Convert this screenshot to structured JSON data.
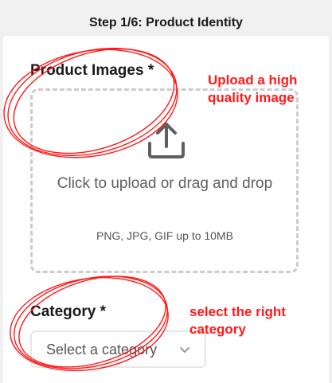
{
  "header": {
    "title": "Step 1/6: Product Identity"
  },
  "product_images": {
    "label": "Product Images *",
    "upload_main": "Click to upload or drag and drop",
    "upload_sub": "PNG, JPG, GIF up to 10MB",
    "icon": "upload-icon"
  },
  "category": {
    "label": "Category *",
    "placeholder": "Select a category",
    "icon": "chevron-down-icon"
  },
  "annotations": {
    "note_upload_line1": "Upload a high",
    "note_upload_line2": "quality image",
    "note_category_line1": "select the right",
    "note_category_line2": "category",
    "color": "#ff1a1a"
  }
}
